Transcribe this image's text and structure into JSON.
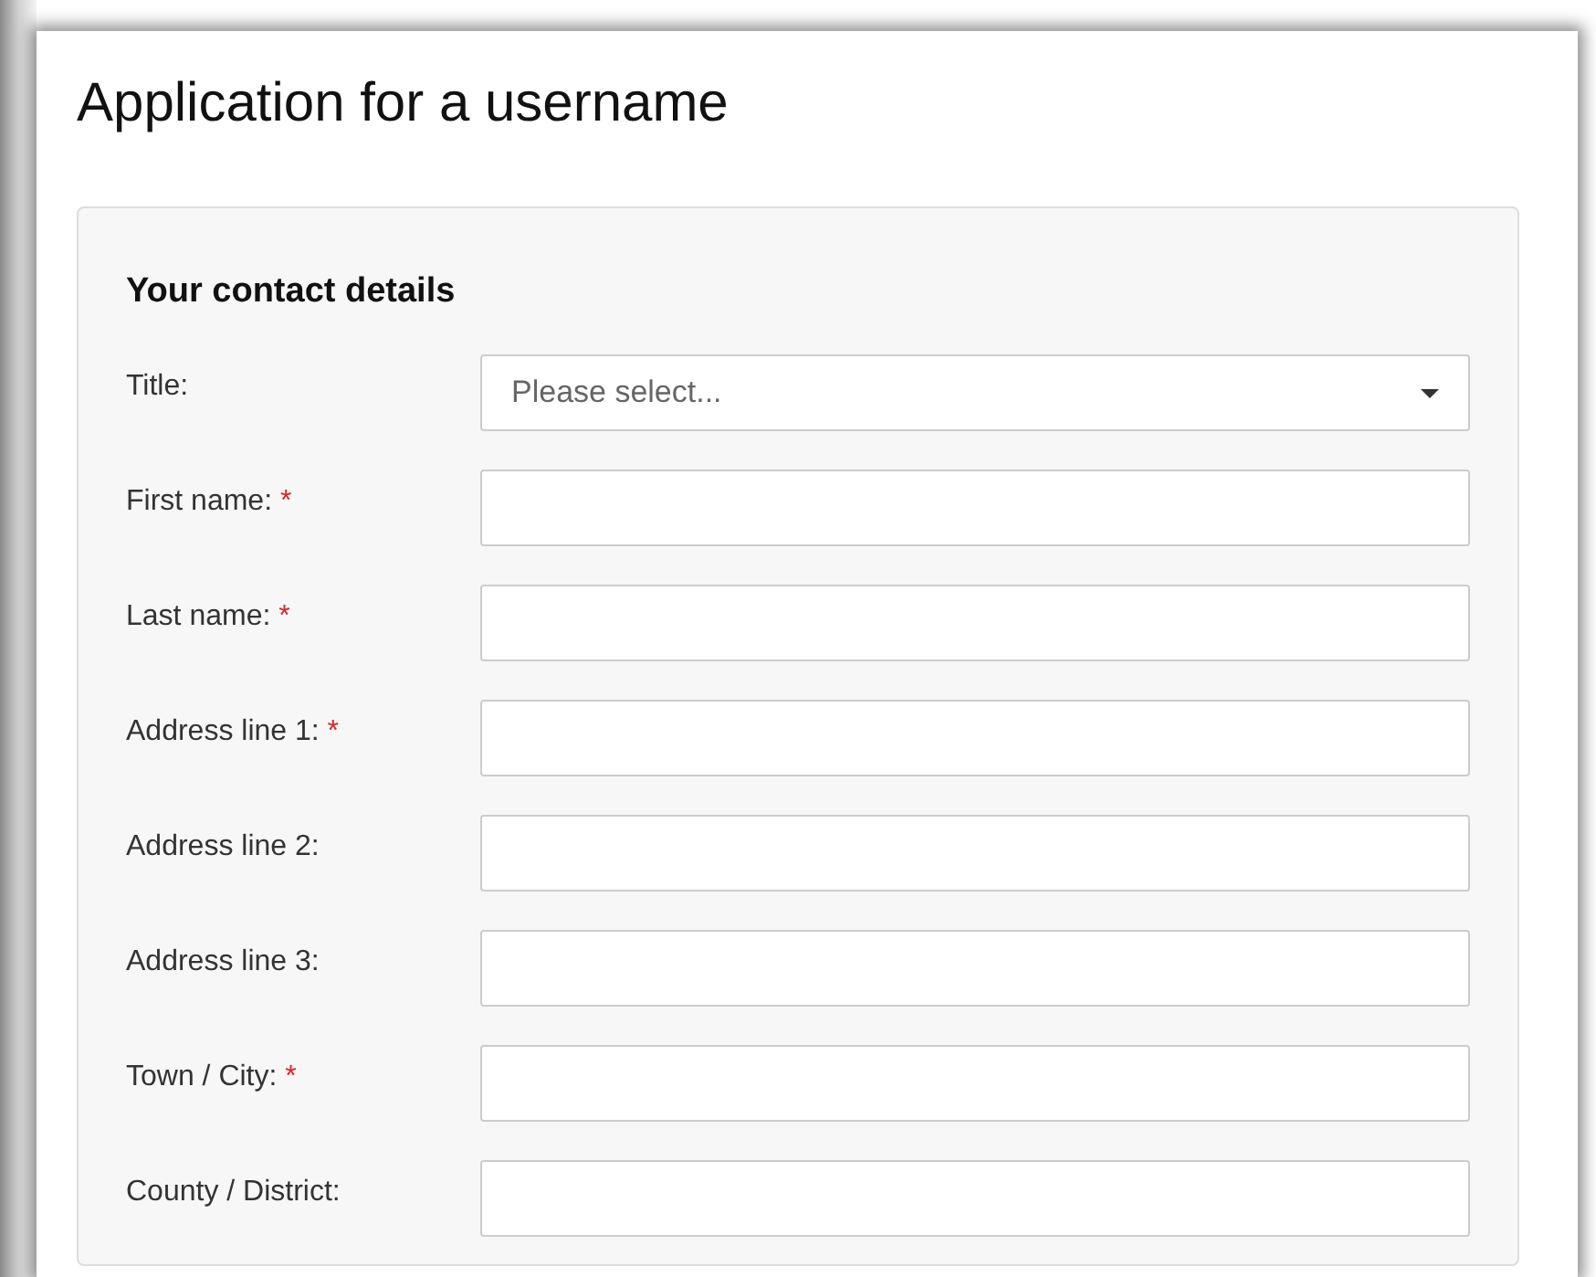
{
  "page_title": "Application for a username",
  "required_marker": "*",
  "section": {
    "heading": "Your contact details",
    "fields": [
      {
        "kind": "select",
        "label": "Title:",
        "required": false,
        "placeholder": "Please select..."
      },
      {
        "kind": "text",
        "label": "First name:",
        "required": true
      },
      {
        "kind": "text",
        "label": "Last name:",
        "required": true
      },
      {
        "kind": "text",
        "label": "Address line 1:",
        "required": true
      },
      {
        "kind": "text",
        "label": "Address line 2:",
        "required": false
      },
      {
        "kind": "text",
        "label": "Address line 3:",
        "required": false
      },
      {
        "kind": "text",
        "label": "Town / City:",
        "required": true
      },
      {
        "kind": "text",
        "label": "County / District:",
        "required": false
      }
    ]
  }
}
